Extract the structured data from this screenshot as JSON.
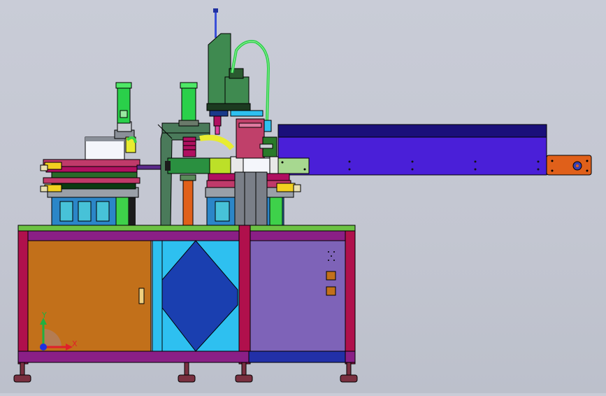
{
  "viewport": {
    "background_color": "#c6c9d4",
    "description_hidden": ""
  },
  "triad": {
    "x_label": "X",
    "y_label": "Y",
    "x_color": "#e0202a",
    "y_color": "#20b040",
    "z_color": "#2030e0"
  },
  "colors": {
    "cabinet_orange": "#c2701a",
    "cabinet_purple": "#7e63b8",
    "frame_magenta": "#b0104c",
    "panel_blue": "#1a3fb0",
    "panel_cyan": "#2ec0f0",
    "conveyor_blue": "#4a1fd8",
    "robot_green": "#3f8a50",
    "cylinder_green": "#2ad04a",
    "bracket_orange": "#e0601a"
  },
  "cabinet": {
    "door_handle": "handle-icon",
    "buttons": [
      "button-icon",
      "button-icon"
    ]
  }
}
